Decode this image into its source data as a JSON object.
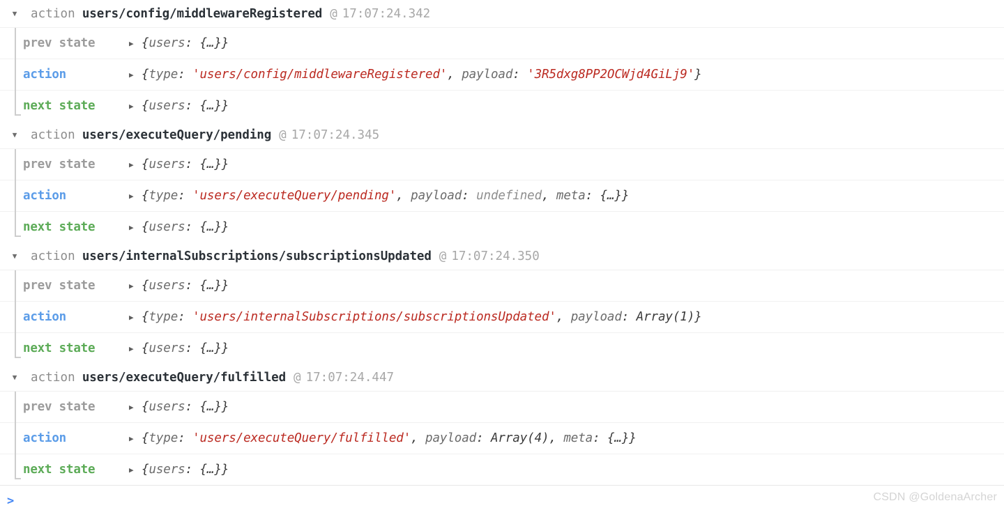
{
  "console": {
    "prompt": {
      "caret": ">",
      "value": "",
      "placeholder": ""
    },
    "watermark": "CSDN @GoldenaArcher",
    "icons": {
      "disclosure_open": "▼",
      "disclosure_closed": "▶"
    },
    "colors": {
      "prev_state_label": "#9b9b9b",
      "action_label": "#5b9ce8",
      "next_state_label": "#5cab57",
      "string_literal": "#bb2a21",
      "action_type": "#2b3137",
      "timestamp": "#a7a7a7",
      "prompt_caret": "#4285f4",
      "guide_line": "#cdcdcd",
      "row_border": "#f1f1f1"
    }
  },
  "groups": [
    {
      "kind": "action",
      "type": "users/config/middlewareRegistered",
      "at": "@",
      "time": "17:07:24.342",
      "entries": [
        {
          "label": "prev state",
          "label_kind": "prev",
          "arrow": "▶",
          "tokens": [
            {
              "t": "punct",
              "v": "{"
            },
            {
              "t": "key",
              "v": "users"
            },
            {
              "t": "punct",
              "v": ": "
            },
            {
              "t": "obj",
              "v": "{…}}"
            }
          ]
        },
        {
          "label": "action",
          "label_kind": "act",
          "arrow": "▶",
          "tokens": [
            {
              "t": "punct",
              "v": "{"
            },
            {
              "t": "key",
              "v": "type"
            },
            {
              "t": "punct",
              "v": ": "
            },
            {
              "t": "str",
              "v": "'users/config/middlewareRegistered'"
            },
            {
              "t": "punct",
              "v": ", "
            },
            {
              "t": "key",
              "v": "payload"
            },
            {
              "t": "punct",
              "v": ": "
            },
            {
              "t": "str",
              "v": "'3R5dxg8PP2OCWjd4GiLj9'"
            },
            {
              "t": "punct",
              "v": "}"
            }
          ]
        },
        {
          "label": "next state",
          "label_kind": "next",
          "arrow": "▶",
          "tokens": [
            {
              "t": "punct",
              "v": "{"
            },
            {
              "t": "key",
              "v": "users"
            },
            {
              "t": "punct",
              "v": ": "
            },
            {
              "t": "obj",
              "v": "{…}}"
            }
          ]
        }
      ]
    },
    {
      "kind": "action",
      "type": "users/executeQuery/pending",
      "at": "@",
      "time": "17:07:24.345",
      "entries": [
        {
          "label": "prev state",
          "label_kind": "prev",
          "arrow": "▶",
          "tokens": [
            {
              "t": "punct",
              "v": "{"
            },
            {
              "t": "key",
              "v": "users"
            },
            {
              "t": "punct",
              "v": ": "
            },
            {
              "t": "obj",
              "v": "{…}}"
            }
          ]
        },
        {
          "label": "action",
          "label_kind": "act",
          "arrow": "▶",
          "tokens": [
            {
              "t": "punct",
              "v": "{"
            },
            {
              "t": "key",
              "v": "type"
            },
            {
              "t": "punct",
              "v": ": "
            },
            {
              "t": "str",
              "v": "'users/executeQuery/pending'"
            },
            {
              "t": "punct",
              "v": ", "
            },
            {
              "t": "key",
              "v": "payload"
            },
            {
              "t": "punct",
              "v": ": "
            },
            {
              "t": "dim",
              "v": "undefined"
            },
            {
              "t": "punct",
              "v": ", "
            },
            {
              "t": "key",
              "v": "meta"
            },
            {
              "t": "punct",
              "v": ": "
            },
            {
              "t": "obj",
              "v": "{…}}"
            }
          ]
        },
        {
          "label": "next state",
          "label_kind": "next",
          "arrow": "▶",
          "tokens": [
            {
              "t": "punct",
              "v": "{"
            },
            {
              "t": "key",
              "v": "users"
            },
            {
              "t": "punct",
              "v": ": "
            },
            {
              "t": "obj",
              "v": "{…}}"
            }
          ]
        }
      ]
    },
    {
      "kind": "action",
      "type": "users/internalSubscriptions/subscriptionsUpdated",
      "at": "@",
      "time": "17:07:24.350",
      "entries": [
        {
          "label": "prev state",
          "label_kind": "prev",
          "arrow": "▶",
          "tokens": [
            {
              "t": "punct",
              "v": "{"
            },
            {
              "t": "key",
              "v": "users"
            },
            {
              "t": "punct",
              "v": ": "
            },
            {
              "t": "obj",
              "v": "{…}}"
            }
          ]
        },
        {
          "label": "action",
          "label_kind": "act",
          "arrow": "▶",
          "tokens": [
            {
              "t": "punct",
              "v": "{"
            },
            {
              "t": "key",
              "v": "type"
            },
            {
              "t": "punct",
              "v": ": "
            },
            {
              "t": "str",
              "v": "'users/internalSubscriptions/subscriptionsUpdated'"
            },
            {
              "t": "punct",
              "v": ", "
            },
            {
              "t": "key",
              "v": "payload"
            },
            {
              "t": "punct",
              "v": ": "
            },
            {
              "t": "obj",
              "v": "Array(1)}"
            }
          ]
        },
        {
          "label": "next state",
          "label_kind": "next",
          "arrow": "▶",
          "tokens": [
            {
              "t": "punct",
              "v": "{"
            },
            {
              "t": "key",
              "v": "users"
            },
            {
              "t": "punct",
              "v": ": "
            },
            {
              "t": "obj",
              "v": "{…}}"
            }
          ]
        }
      ]
    },
    {
      "kind": "action",
      "type": "users/executeQuery/fulfilled",
      "at": "@",
      "time": "17:07:24.447",
      "entries": [
        {
          "label": "prev state",
          "label_kind": "prev",
          "arrow": "▶",
          "tokens": [
            {
              "t": "punct",
              "v": "{"
            },
            {
              "t": "key",
              "v": "users"
            },
            {
              "t": "punct",
              "v": ": "
            },
            {
              "t": "obj",
              "v": "{…}}"
            }
          ]
        },
        {
          "label": "action",
          "label_kind": "act",
          "arrow": "▶",
          "tokens": [
            {
              "t": "punct",
              "v": "{"
            },
            {
              "t": "key",
              "v": "type"
            },
            {
              "t": "punct",
              "v": ": "
            },
            {
              "t": "str",
              "v": "'users/executeQuery/fulfilled'"
            },
            {
              "t": "punct",
              "v": ", "
            },
            {
              "t": "key",
              "v": "payload"
            },
            {
              "t": "punct",
              "v": ": "
            },
            {
              "t": "obj",
              "v": "Array(4)"
            },
            {
              "t": "punct",
              "v": ", "
            },
            {
              "t": "key",
              "v": "meta"
            },
            {
              "t": "punct",
              "v": ": "
            },
            {
              "t": "obj",
              "v": "{…}}"
            }
          ]
        },
        {
          "label": "next state",
          "label_kind": "next",
          "arrow": "▶",
          "tokens": [
            {
              "t": "punct",
              "v": "{"
            },
            {
              "t": "key",
              "v": "users"
            },
            {
              "t": "punct",
              "v": ": "
            },
            {
              "t": "obj",
              "v": "{…}}"
            }
          ]
        }
      ]
    }
  ]
}
